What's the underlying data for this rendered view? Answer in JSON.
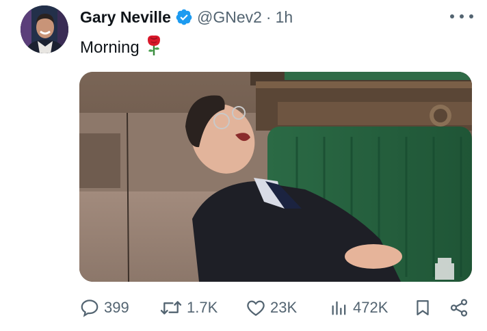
{
  "tweet": {
    "display_name": "Gary Neville",
    "verified": true,
    "handle": "@GNev2",
    "separator": "·",
    "time": "1h",
    "text": "Morning",
    "emoji": "rose-emoji",
    "media_description_icon": "photo"
  },
  "icons": {
    "avatar": "avatar",
    "verified": "verified-badge-icon",
    "more": "more-options-icon",
    "reply": "reply-icon",
    "retweet": "retweet-icon",
    "like": "heart-icon",
    "views": "views-icon",
    "bookmark": "bookmark-icon",
    "share": "share-icon"
  },
  "actions": {
    "replies": "399",
    "retweets": "1.7K",
    "likes": "23K",
    "views": "472K"
  },
  "colors": {
    "verified_blue": "#1d9bf0",
    "text_primary": "#0f1419",
    "text_secondary": "#536471",
    "bench_green": "#2f6b47"
  }
}
